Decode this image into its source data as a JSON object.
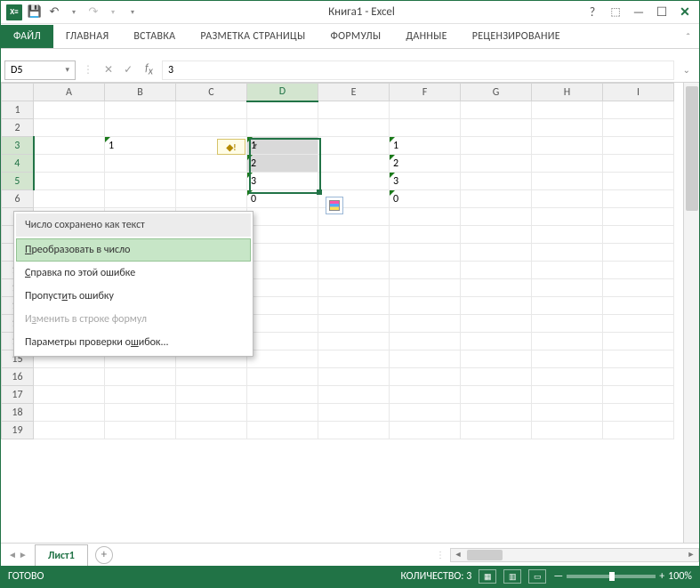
{
  "title": "Книга1 - Excel",
  "ribbon": {
    "file": "ФАЙЛ",
    "home": "ГЛАВНАЯ",
    "insert": "ВСТАВКА",
    "pagelayout": "РАЗМЕТКА СТРАНИЦЫ",
    "formulas": "ФОРМУЛЫ",
    "data": "ДАННЫЕ",
    "review": "РЕЦЕНЗИРОВАНИЕ"
  },
  "namebox": "D5",
  "fx_value": "3",
  "columns": [
    "A",
    "B",
    "C",
    "D",
    "E",
    "F",
    "G",
    "H",
    "I"
  ],
  "selected_col": "D",
  "selected_rows": [
    3,
    4,
    5
  ],
  "active_cell": "D5",
  "cells": {
    "B3": "1",
    "D3": "1",
    "F3": "1",
    "D4": "2",
    "F4": "2",
    "D5": "3",
    "F5": "3",
    "D6": "0",
    "F6": "0"
  },
  "text_flag_cells": [
    "B3",
    "D3",
    "D4",
    "D5",
    "D6",
    "F3",
    "F4",
    "F5",
    "F6"
  ],
  "context_menu": {
    "title": "Число сохранено как текст",
    "items": [
      {
        "key": "convert",
        "label": "Преобразовать в число",
        "accel": "П",
        "hover": true
      },
      {
        "key": "help",
        "label": "Справка по этой ошибке",
        "accel": "С"
      },
      {
        "key": "ignore",
        "label": "Пропустить ошибку",
        "accel": "и"
      },
      {
        "key": "editfx",
        "label": "Изменить в строке формул",
        "accel": "з",
        "disabled": true
      },
      {
        "key": "options",
        "label": "Параметры проверки ошибок...",
        "accel": "ш"
      }
    ]
  },
  "sheet_tab": "Лист1",
  "status": {
    "ready": "ГОТОВО",
    "count_label": "КОЛИЧЕСТВО: 3",
    "zoom": "100%"
  }
}
